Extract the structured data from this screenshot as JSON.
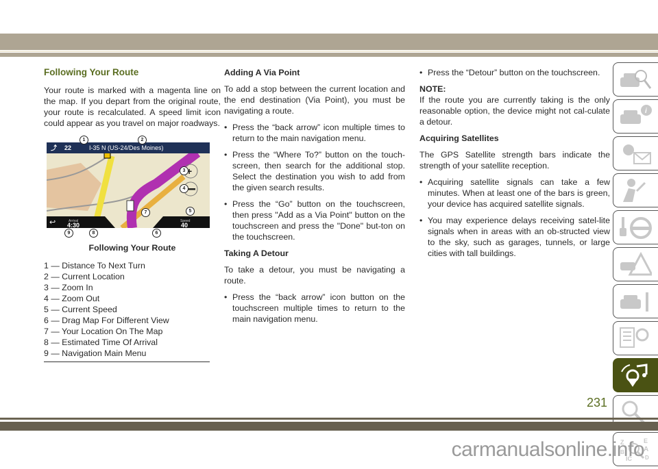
{
  "column1": {
    "heading": "Following Your Route",
    "paragraph": "Your route is marked with a magenta line on the map. If you depart from the original route, your route is recalculated. A speed limit icon could appear as you travel on major roadways.",
    "figure": {
      "screen": {
        "distance": "22",
        "road": "I-35 N (US-24/Des Moines)",
        "arrival_label": "Arrival",
        "arrival_time": "4:30",
        "speed_label": "Speed",
        "speed": "40",
        "callouts": [
          "1",
          "2",
          "3",
          "4",
          "5",
          "6",
          "7",
          "8",
          "9"
        ]
      },
      "caption": "Following Your Route",
      "legend": [
        "1 — Distance To Next Turn",
        "2 — Current Location",
        "3 — Zoom In",
        "4 — Zoom Out",
        "5 — Current Speed",
        "6 — Drag Map For Different View",
        "7 — Your Location On The Map",
        "8 — Estimated Time Of Arrival",
        "9 — Navigation Main Menu"
      ]
    }
  },
  "column2": {
    "heading1": "Adding A Via Point",
    "para1": "To add a stop between the current location and the end destination (Via Point), you must be navigating a route.",
    "bullets1": [
      "Press the “back arrow” icon multiple times to return to the main navigation menu.",
      "Press the “Where To?” button on the touch-screen, then search for the additional stop. Select the destination you wish to add from the given search results.",
      "Press the “Go” button on the touchscreen, then press \"Add as a Via Point\" button on the touchscreen and press the \"Done\" but-ton on the touchscreen."
    ],
    "heading2": "Taking A Detour",
    "para2": "To take a detour, you must be navigating a route.",
    "bullets2": [
      "Press the “back arrow” icon button on the touchscreen multiple times to return to the main navigation menu."
    ]
  },
  "column3": {
    "bullets1": [
      "Press the “Detour” button on the touchscreen."
    ],
    "note_label": "NOTE:",
    "note_text": "If the route you are currently taking is the only reasonable option, the device might not cal-culate a detour.",
    "heading": "Acquiring Satellites",
    "para": "The GPS Satellite strength bars indicate the strength of your satellite reception.",
    "bullets2": [
      "Acquiring satellite signals can take a few minutes. When at least one of the bars is green, your device has acquired satellite signals.",
      "You may experience delays receiving satel-lite signals when in areas with an ob-structed view to the sky, such as garages, tunnels, or large cities with tall buildings."
    ]
  },
  "tabs": [
    {
      "icon": "car-search-icon",
      "active": false
    },
    {
      "icon": "car-info-icon",
      "active": false
    },
    {
      "icon": "warning-light-message-icon",
      "active": false
    },
    {
      "icon": "airbag-seat-icon",
      "active": false
    },
    {
      "icon": "key-steering-wheel-icon",
      "active": false
    },
    {
      "icon": "car-hazard-icon",
      "active": false
    },
    {
      "icon": "car-wrench-icon",
      "active": false
    },
    {
      "icon": "specs-gear-icon",
      "active": false
    },
    {
      "icon": "multimedia-navigation-icon",
      "active": true
    },
    {
      "icon": "search-icon",
      "active": false
    },
    {
      "icon": "alphabetical-index-icon",
      "active": false
    }
  ],
  "page_number": "231",
  "watermark": "carmanualsonline.info",
  "colors": {
    "heading_green": "#5b6e22",
    "band_top": "#aea593",
    "band_bottom": "#676050",
    "active_tab": "#4a5213",
    "route_magenta": "#b030b0"
  }
}
